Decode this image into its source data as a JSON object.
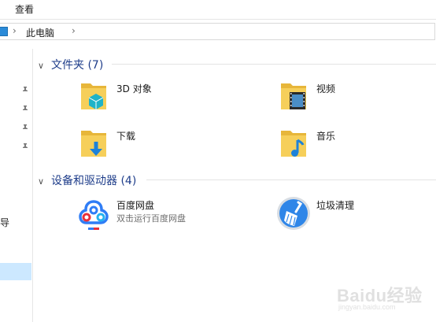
{
  "ribbon": {
    "tab_view": "查看"
  },
  "address": {
    "crumb": "此电脑",
    "separator": "›"
  },
  "nav": {
    "partial_label": "导"
  },
  "groups": [
    {
      "title": "文件夹 (7)",
      "expanded": true
    },
    {
      "title": "设备和驱动器 (4)",
      "expanded": true
    }
  ],
  "folders": [
    {
      "name": "3D 对象",
      "icon": "3d-objects-folder-icon"
    },
    {
      "name": "视频",
      "icon": "videos-folder-icon"
    },
    {
      "name": "下载",
      "icon": "downloads-folder-icon"
    },
    {
      "name": "音乐",
      "icon": "music-folder-icon"
    }
  ],
  "drives": [
    {
      "name": "百度网盘",
      "sub": "双击运行百度网盘",
      "icon": "baidu-netdisk-icon"
    },
    {
      "name": "垃圾清理",
      "icon": "cleanup-broom-icon"
    }
  ],
  "watermark": {
    "text": "Baidu经验",
    "sub": "jingyan.baidu.com"
  },
  "colors": {
    "accent": "#1e3d8a",
    "folder": "#f3c84b",
    "selected": "#cce8ff"
  }
}
